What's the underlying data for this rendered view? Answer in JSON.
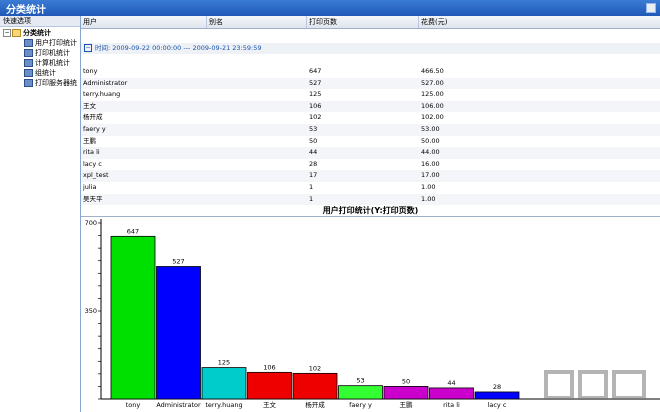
{
  "window": {
    "title": "分类统计"
  },
  "sidebar": {
    "header": "快速选项",
    "root": "分类统计",
    "items": [
      {
        "label": "用户打印统计"
      },
      {
        "label": "打印机统计"
      },
      {
        "label": "计算机统计"
      },
      {
        "label": "组统计"
      },
      {
        "label": "打印服务器统"
      }
    ]
  },
  "table": {
    "columns": [
      "用户",
      "别名",
      "打印页数",
      "花费(元)"
    ],
    "group_label": "时间: 2009-09-22 00:00:00 --- 2009-09-21 23:59:59",
    "rows": [
      {
        "user": "tony",
        "alias": "",
        "pages": "647",
        "cost": "466.50"
      },
      {
        "user": "Administrator",
        "alias": "",
        "pages": "527",
        "cost": "527.00"
      },
      {
        "user": "terry.huang",
        "alias": "",
        "pages": "125",
        "cost": "125.00"
      },
      {
        "user": "王文",
        "alias": "",
        "pages": "106",
        "cost": "106.00"
      },
      {
        "user": "杨开成",
        "alias": "",
        "pages": "102",
        "cost": "102.00"
      },
      {
        "user": "faery y",
        "alias": "",
        "pages": "53",
        "cost": "53.00"
      },
      {
        "user": "王鹏",
        "alias": "",
        "pages": "50",
        "cost": "50.00"
      },
      {
        "user": "rita li",
        "alias": "",
        "pages": "44",
        "cost": "44.00"
      },
      {
        "user": "lacy c",
        "alias": "",
        "pages": "28",
        "cost": "16.00"
      },
      {
        "user": "xpl_test",
        "alias": "",
        "pages": "17",
        "cost": "17.00"
      },
      {
        "user": "julia",
        "alias": "",
        "pages": "1",
        "cost": "1.00"
      },
      {
        "user": "吴天平",
        "alias": "",
        "pages": "1",
        "cost": "1.00"
      }
    ]
  },
  "chart_data": {
    "type": "bar",
    "title": "用户打印统计(Y:打印页数)",
    "categories": [
      "tony",
      "Administrator",
      "terry.huang",
      "王文",
      "杨开成",
      "faery y",
      "王鹏",
      "rita li",
      "lacy c"
    ],
    "values": [
      647,
      527,
      125,
      106,
      102,
      53,
      50,
      44,
      28
    ],
    "colors": [
      "#00e000",
      "#0000ff",
      "#00cccc",
      "#ee0000",
      "#ee0000",
      "#33ff33",
      "#cc00cc",
      "#cc00cc",
      "#0000ff"
    ],
    "ylim": [
      0,
      700
    ],
    "yticks": [
      "700",
      "350"
    ],
    "grid": false
  },
  "watermark": {
    "text": "下载吧"
  }
}
